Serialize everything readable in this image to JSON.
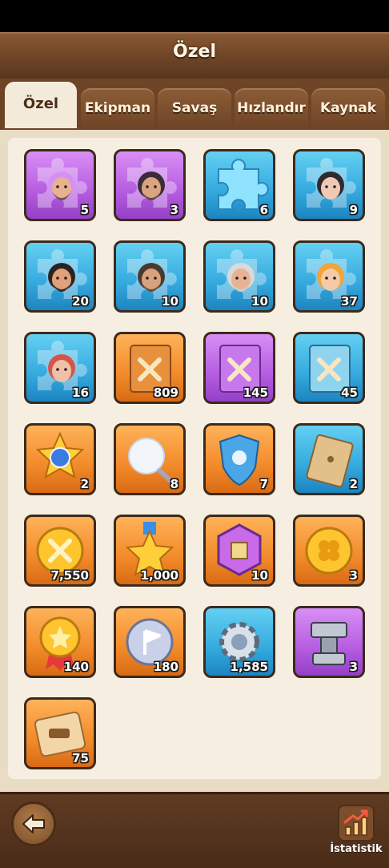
{
  "header": {
    "title": "Özel"
  },
  "tabs": [
    {
      "label": "Özel",
      "active": true
    },
    {
      "label": "Ekipman",
      "active": false
    },
    {
      "label": "Savaş",
      "active": false
    },
    {
      "label": "Hızlandır",
      "active": false
    },
    {
      "label": "Kaynak",
      "active": false
    }
  ],
  "items": [
    {
      "icon": "hero-puzzle-bald-bearded-icon",
      "rarity": "purple",
      "count": "5"
    },
    {
      "icon": "hero-puzzle-hooded-bearded-icon",
      "rarity": "purple",
      "count": "3"
    },
    {
      "icon": "puzzle-piece-icon",
      "rarity": "blue",
      "count": "6"
    },
    {
      "icon": "hero-puzzle-dark-hair-woman-icon",
      "rarity": "blue",
      "count": "9"
    },
    {
      "icon": "hero-puzzle-red-mask-man-icon",
      "rarity": "blue",
      "count": "20"
    },
    {
      "icon": "hero-puzzle-warrior-man-icon",
      "rarity": "blue",
      "count": "10"
    },
    {
      "icon": "hero-puzzle-old-man-icon",
      "rarity": "blue",
      "count": "10"
    },
    {
      "icon": "hero-puzzle-blonde-woman-icon",
      "rarity": "blue",
      "count": "37"
    },
    {
      "icon": "hero-puzzle-red-hair-woman-icon",
      "rarity": "blue",
      "count": "16"
    },
    {
      "icon": "skill-book-orange-icon",
      "rarity": "orange",
      "count": "809"
    },
    {
      "icon": "skill-book-purple-icon",
      "rarity": "purple",
      "count": "145"
    },
    {
      "icon": "skill-book-blue-icon",
      "rarity": "blue",
      "count": "45"
    },
    {
      "icon": "star-medal-orb-icon",
      "rarity": "orange",
      "count": "2"
    },
    {
      "icon": "snowball-icon",
      "rarity": "orange",
      "count": "8"
    },
    {
      "icon": "frozen-shield-icon",
      "rarity": "orange",
      "count": "7"
    },
    {
      "icon": "envelope-icon",
      "rarity": "blue",
      "count": "2"
    },
    {
      "icon": "gold-sword-coin-icon",
      "rarity": "orange",
      "count": "7,550"
    },
    {
      "icon": "gold-star-medal-icon",
      "rarity": "orange",
      "count": "1,000"
    },
    {
      "icon": "purple-hexagon-badge-icon",
      "rarity": "orange",
      "count": "10"
    },
    {
      "icon": "clover-coin-icon",
      "rarity": "orange",
      "count": "3"
    },
    {
      "icon": "gold-star-ribbon-medal-icon",
      "rarity": "orange",
      "count": "140"
    },
    {
      "icon": "silver-flag-coin-icon",
      "rarity": "orange",
      "count": "180"
    },
    {
      "icon": "gear-icon",
      "rarity": "blue",
      "count": "1,585"
    },
    {
      "icon": "anvil-icon",
      "rarity": "purple",
      "count": "3"
    },
    {
      "icon": "tank-scroll-icon",
      "rarity": "orange",
      "count": "75"
    }
  ],
  "footer": {
    "back_icon": "back-arrow-icon",
    "stats_label": "İstatistik",
    "stats_icon": "bar-chart-up-icon"
  }
}
